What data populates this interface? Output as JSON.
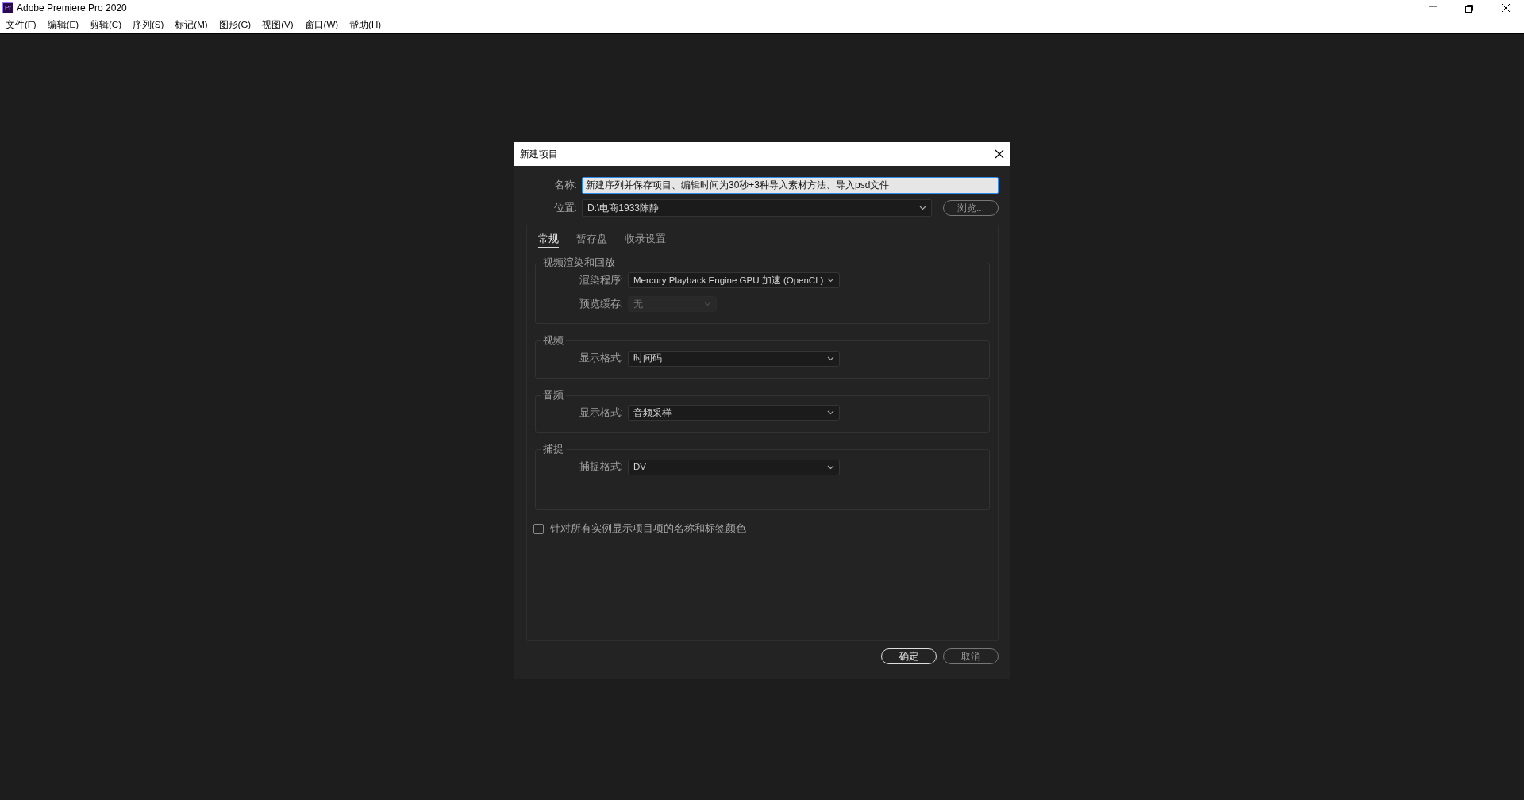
{
  "window": {
    "app_icon": "Pr",
    "title": "Adobe Premiere Pro 2020"
  },
  "menu": [
    "文件(F)",
    "编辑(E)",
    "剪辑(C)",
    "序列(S)",
    "标记(M)",
    "图形(G)",
    "视图(V)",
    "窗口(W)",
    "帮助(H)"
  ],
  "dialog": {
    "title": "新建项目",
    "name": {
      "label": "名称:",
      "value": "新建序列并保存项目、编辑时间为30秒+3种导入素材方法、导入psd文件"
    },
    "location": {
      "label": "位置:",
      "value": "D:\\电商1933陈静"
    },
    "browse_button": "浏览...",
    "tabs": [
      {
        "label": "常规",
        "selected": true
      },
      {
        "label": "暂存盘",
        "selected": false
      },
      {
        "label": "收录设置",
        "selected": false
      }
    ],
    "sections": [
      {
        "title": "视频渲染和回放",
        "rows": [
          {
            "label": "渲染程序:",
            "value": "Mercury Playback Engine GPU 加速 (OpenCL)",
            "disabled": false
          },
          {
            "label": "预览缓存:",
            "value": "无",
            "disabled": true
          }
        ]
      },
      {
        "title": "视频",
        "rows": [
          {
            "label": "显示格式:",
            "value": "时间码",
            "disabled": false
          }
        ]
      },
      {
        "title": "音频",
        "rows": [
          {
            "label": "显示格式:",
            "value": "音频采样",
            "disabled": false
          }
        ]
      },
      {
        "title": "捕捉",
        "rows": [
          {
            "label": "捕捉格式:",
            "value": "DV",
            "disabled": false
          }
        ]
      }
    ],
    "checkbox": {
      "label": "针对所有实例显示项目项的名称和标签颜色",
      "checked": false
    },
    "buttons": [
      {
        "label": "确定",
        "default": true
      },
      {
        "label": "取消",
        "default": false
      }
    ]
  }
}
